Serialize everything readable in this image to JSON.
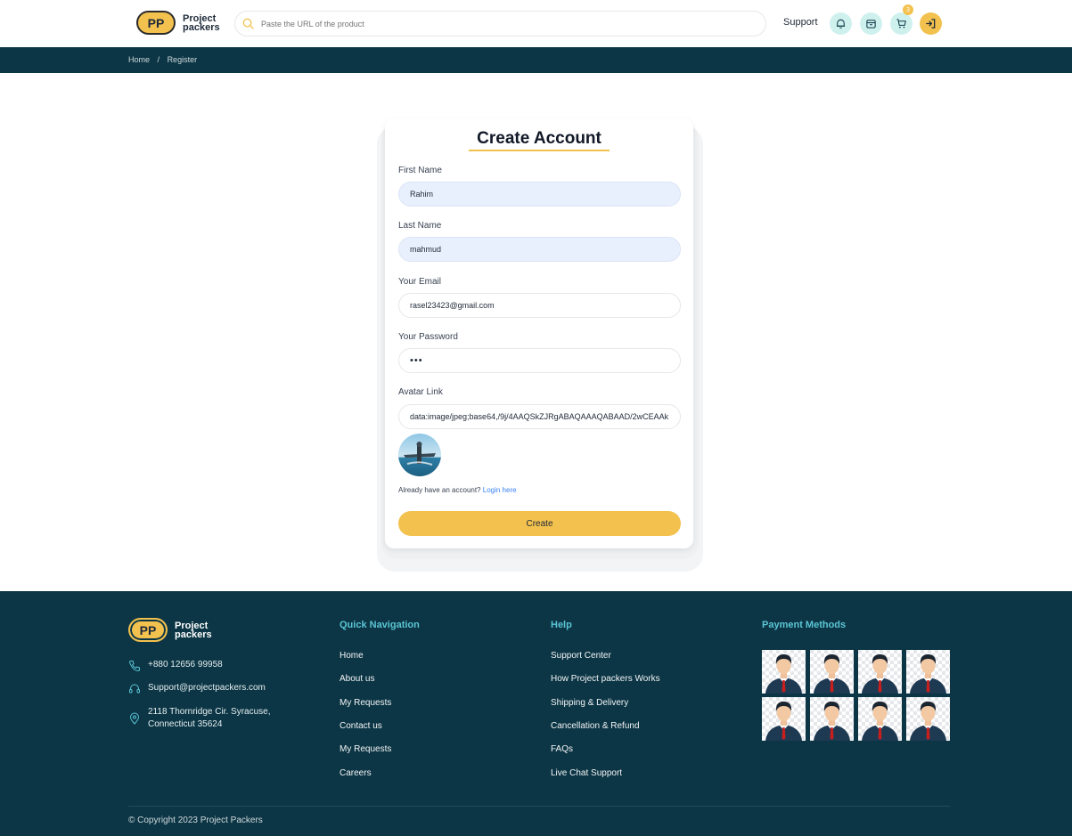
{
  "header": {
    "logo_badge": "PP",
    "logo_line1": "Project",
    "logo_line2": "packers",
    "search_placeholder": "Paste the URL of the product",
    "support_label": "Support",
    "cart_count": "3"
  },
  "breadcrumb": {
    "home": "Home",
    "separator": "/",
    "current": "Register"
  },
  "form": {
    "title": "Create Account",
    "first_name_label": "First Name",
    "first_name_value": "Rahim",
    "last_name_label": "Last Name",
    "last_name_value": "mahmud",
    "email_label": "Your Email",
    "email_value": "rasel23423@gmail.com",
    "password_label": "Your Password",
    "password_value": "•••",
    "avatar_label": "Avatar Link",
    "avatar_value": "data:image/jpeg;base64,/9j/4AAQSkZJRgABAQAAAQABAAD/2wCEAAk",
    "already_text": "Already have an account?",
    "login_link": "Login here",
    "create_button": "Create"
  },
  "footer": {
    "logo_badge": "PP",
    "logo_line1": "Project",
    "logo_line2": "packers",
    "phone": "+880 12656 99958",
    "email": "Support@projectpackers.com",
    "address_line1": "2118 Thornridge Cir. Syracuse,",
    "address_line2": "Connecticut 35624",
    "quick_nav_title": "Quick Navigation",
    "quick_nav": [
      "Home",
      "About us",
      "My Requests",
      "Contact us",
      "My Requests",
      "Careers"
    ],
    "help_title": "Help",
    "help": [
      "Support Center",
      "How Project packers Works",
      "Shipping & Delivery",
      "Cancellation & Refund",
      "FAQs",
      "Live Chat Support"
    ],
    "payment_title": "Payment Methods",
    "copyright": "© Copyright 2023 Project Packers"
  },
  "colors": {
    "accent": "#f2c14e",
    "navy": "#0c3645",
    "teal_heading": "#5bc5d6",
    "icon_bg": "#cff1ee"
  }
}
